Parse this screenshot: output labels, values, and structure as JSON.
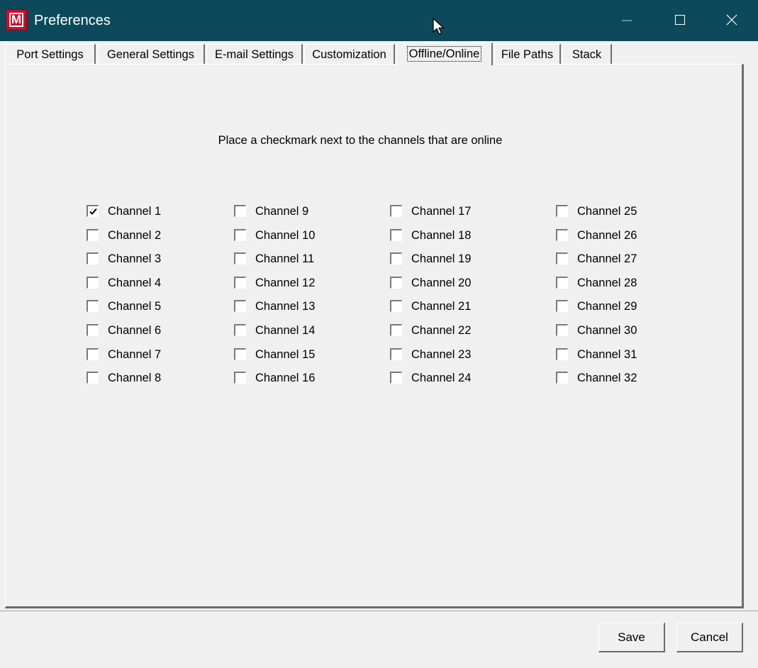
{
  "window": {
    "title": "Preferences",
    "icon": "app-m-icon",
    "icon_letter": "M",
    "titlebar_color": "#0c4a5b",
    "icon_color": "#c8102e"
  },
  "tabs": [
    {
      "label": "Port Settings",
      "active": false
    },
    {
      "label": "General Settings",
      "active": false
    },
    {
      "label": "E-mail Settings",
      "active": false
    },
    {
      "label": "Customization",
      "active": false
    },
    {
      "label": "Offline/Online",
      "active": true
    },
    {
      "label": "File Paths",
      "active": false
    },
    {
      "label": "Stack",
      "active": false
    }
  ],
  "panel": {
    "instruction": "Place a checkmark next to the channels that are online",
    "columns": [
      [
        {
          "label": "Channel 1",
          "checked": true
        },
        {
          "label": "Channel 2",
          "checked": false
        },
        {
          "label": "Channel 3",
          "checked": false
        },
        {
          "label": "Channel 4",
          "checked": false
        },
        {
          "label": "Channel 5",
          "checked": false
        },
        {
          "label": "Channel 6",
          "checked": false
        },
        {
          "label": "Channel 7",
          "checked": false
        },
        {
          "label": "Channel 8",
          "checked": false
        }
      ],
      [
        {
          "label": "Channel 9",
          "checked": false
        },
        {
          "label": "Channel 10",
          "checked": false
        },
        {
          "label": "Channel 11",
          "checked": false
        },
        {
          "label": "Channel 12",
          "checked": false
        },
        {
          "label": "Channel 13",
          "checked": false
        },
        {
          "label": "Channel 14",
          "checked": false
        },
        {
          "label": "Channel 15",
          "checked": false
        },
        {
          "label": "Channel 16",
          "checked": false
        }
      ],
      [
        {
          "label": "Channel 17",
          "checked": false
        },
        {
          "label": "Channel 18",
          "checked": false
        },
        {
          "label": "Channel 19",
          "checked": false
        },
        {
          "label": "Channel 20",
          "checked": false
        },
        {
          "label": "Channel 21",
          "checked": false
        },
        {
          "label": "Channel 22",
          "checked": false
        },
        {
          "label": "Channel 23",
          "checked": false
        },
        {
          "label": "Channel 24",
          "checked": false
        }
      ],
      [
        {
          "label": "Channel 25",
          "checked": false
        },
        {
          "label": "Channel 26",
          "checked": false
        },
        {
          "label": "Channel 27",
          "checked": false
        },
        {
          "label": "Channel 28",
          "checked": false
        },
        {
          "label": "Channel 29",
          "checked": false
        },
        {
          "label": "Channel 30",
          "checked": false
        },
        {
          "label": "Channel 31",
          "checked": false
        },
        {
          "label": "Channel 32",
          "checked": false
        }
      ]
    ]
  },
  "buttons": {
    "save_label": "Save",
    "cancel_label": "Cancel"
  }
}
